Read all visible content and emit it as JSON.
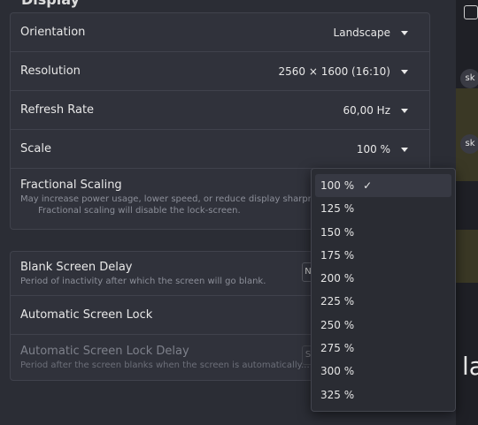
{
  "header": {
    "title": "Display"
  },
  "display_settings": {
    "orientation": {
      "label": "Orientation",
      "value": "Landscape"
    },
    "resolution": {
      "label": "Resolution",
      "value": "2560 × 1600 (16:10)"
    },
    "refresh_rate": {
      "label": "Refresh Rate",
      "value": "60,00 Hz"
    },
    "scale": {
      "label": "Scale",
      "value": "100 %"
    },
    "fractional_scaling": {
      "label": "Fractional Scaling",
      "description": "May increase power usage, lower speed, or reduce display sharpness.",
      "warning": "Fractional scaling will disable the lock-screen."
    }
  },
  "screen_settings": {
    "blank_delay": {
      "label": "Blank Screen Delay",
      "description": "Period of inactivity after which the screen will go blank.",
      "button_char": "N"
    },
    "auto_lock": {
      "label": "Automatic Screen Lock"
    },
    "auto_lock_delay": {
      "label": "Automatic Screen Lock Delay",
      "description": "Period after the screen blanks when the screen is automatically...",
      "button_char": "S"
    }
  },
  "scale_dropdown": {
    "selected": "100 %",
    "options": [
      "100 %",
      "125 %",
      "150 %",
      "175 %",
      "200 %",
      "225 %",
      "250 %",
      "275 %",
      "300 %",
      "325 %"
    ]
  },
  "side_panel": {
    "avatar1": "sk",
    "avatar2": "sk",
    "big_text": "la"
  }
}
